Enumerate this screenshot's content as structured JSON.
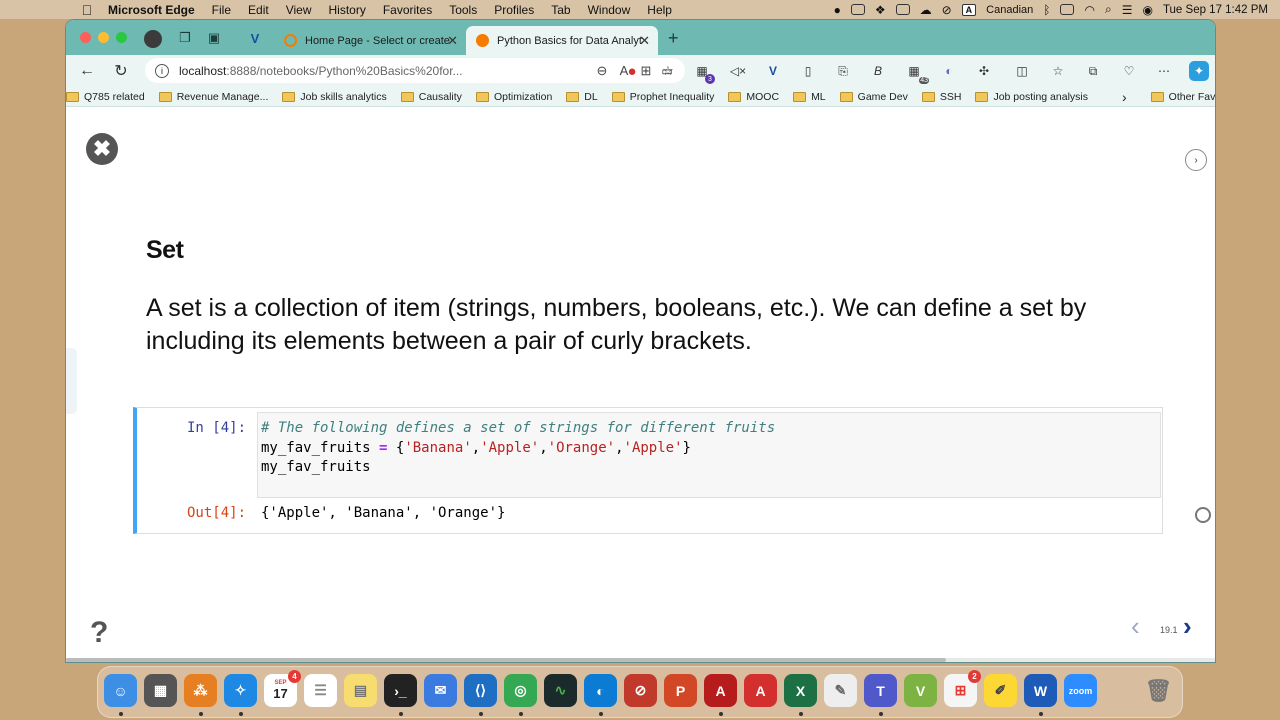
{
  "menubar": {
    "app": "Microsoft Edge",
    "items": [
      "File",
      "Edit",
      "View",
      "History",
      "Favorites",
      "Tools",
      "Profiles",
      "Tab",
      "Window",
      "Help"
    ],
    "input_source_letter": "A",
    "input_source": "Canadian",
    "datetime": "Tue Sep 17  1:42 PM"
  },
  "browser": {
    "tabs": [
      {
        "title": "Home Page - Select or create a notebook",
        "favicon_color": "#f57c00",
        "active": false
      },
      {
        "title": "Python Basics for Data Analytics",
        "favicon_color": "#f57c00",
        "active": true
      }
    ],
    "url_host": "localhost",
    "url_rest": ":8888/notebooks/Python%20Basics%20for...",
    "ext_badges": {
      "ext3": "3",
      "ext13": "43"
    },
    "bookmarks": [
      "Q785 related",
      "Revenue Manage...",
      "Job skills analytics",
      "Causality",
      "Optimization",
      "DL",
      "Prophet Inequality",
      "MOOC",
      "ML",
      "Game Dev",
      "SSH",
      "Job posting analysis"
    ],
    "bookmarks_more": "›",
    "other_favorites": "Other Favorites"
  },
  "notebook": {
    "heading": "Set",
    "paragraph": "A set is a collection of item (strings, numbers, booleans, etc.). We can define a set by including its elements between a pair of curly brackets.",
    "cell": {
      "in_prompt": "In [4]:",
      "code_comment": "# The following defines a set of strings for different fruits",
      "code_line2_var": "my_fav_fruits ",
      "code_line2_op": "=",
      "code_line2_open": " {",
      "code_s1": "'Banana'",
      "code_s2": "'Apple'",
      "code_s3": "'Orange'",
      "code_s4": "'Apple'",
      "code_comma": ",",
      "code_close": "}",
      "code_line3": "my_fav_fruits",
      "out_prompt": "Out[4]:",
      "output": "{'Apple', 'Banana', 'Orange'}"
    },
    "slide_number": "19.1",
    "help": "?",
    "close": "✖"
  },
  "dock": {
    "calendar_month": "SEP",
    "calendar_day": "17",
    "calendar_badge": "4",
    "office_badge": "2",
    "zoom_label": "zoom"
  }
}
